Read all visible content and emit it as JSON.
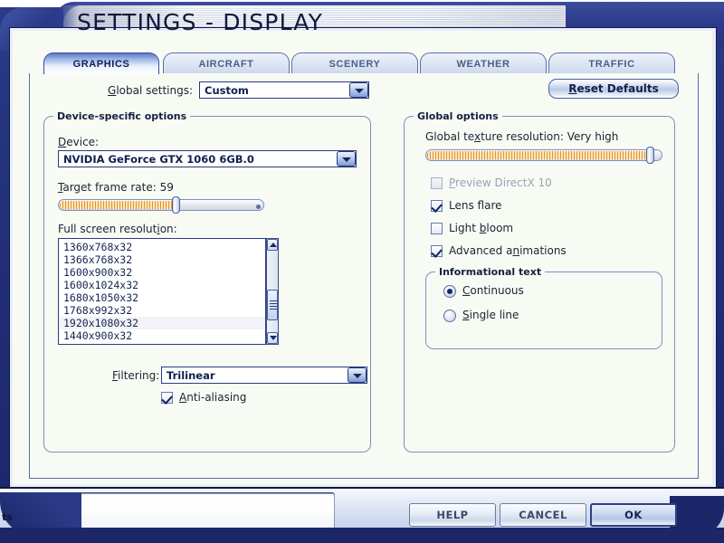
{
  "window": {
    "title": "SETTINGS - DISPLAY",
    "corner_label": "ts"
  },
  "tabs": [
    {
      "label": "GRAPHICS",
      "active": true
    },
    {
      "label": "AIRCRAFT",
      "active": false
    },
    {
      "label": "SCENERY",
      "active": false
    },
    {
      "label": "WEATHER",
      "active": false
    },
    {
      "label": "TRAFFIC",
      "active": false
    }
  ],
  "global_settings": {
    "label": "Global settings:",
    "value": "Custom"
  },
  "reset_defaults": {
    "label": "Reset Defaults"
  },
  "device_options": {
    "group_title": "Device-specific options",
    "device_label": "Device:",
    "device_value": "NVIDIA GeForce GTX 1060 6GB.0",
    "frame_rate_label": "Target frame rate: 59",
    "frame_rate_value": 59,
    "frame_rate_percent": 58,
    "resolution_label": "Full screen resolution:",
    "resolutions": [
      "1360x768x32",
      "1366x768x32",
      "1600x900x32",
      "1600x1024x32",
      "1680x1050x32",
      "1768x992x32",
      "1920x1080x32",
      "1440x900x32"
    ],
    "selected_resolution": "1920x1080x32",
    "filtering_label": "Filtering:",
    "filtering_value": "Trilinear",
    "antialiasing_label": "Anti-aliasing",
    "antialiasing_checked": true
  },
  "global_options": {
    "group_title": "Global options",
    "texture_label": "Global texture resolution: Very high",
    "texture_value": "Very high",
    "texture_percent": 97,
    "checkboxes": [
      {
        "label": "Preview DirectX 10",
        "checked": false,
        "disabled": true
      },
      {
        "label": "Lens flare",
        "checked": true,
        "disabled": false
      },
      {
        "label": "Light bloom",
        "checked": false,
        "disabled": false
      },
      {
        "label": "Advanced animations",
        "checked": true,
        "disabled": false
      }
    ],
    "info_text": {
      "group_title": "Informational text",
      "options": [
        {
          "label": "Continuous",
          "selected": true
        },
        {
          "label": "Single line",
          "selected": false
        }
      ]
    }
  },
  "footer": {
    "buttons": [
      {
        "label": "HELP",
        "primary": false
      },
      {
        "label": "CANCEL",
        "primary": false
      },
      {
        "label": "OK",
        "primary": true
      }
    ]
  },
  "colors": {
    "frame_blue": "#22307a",
    "panel_bg": "#f7fbf4",
    "accent_orange": "#e8921f",
    "tab_border": "#5b6ea8"
  }
}
